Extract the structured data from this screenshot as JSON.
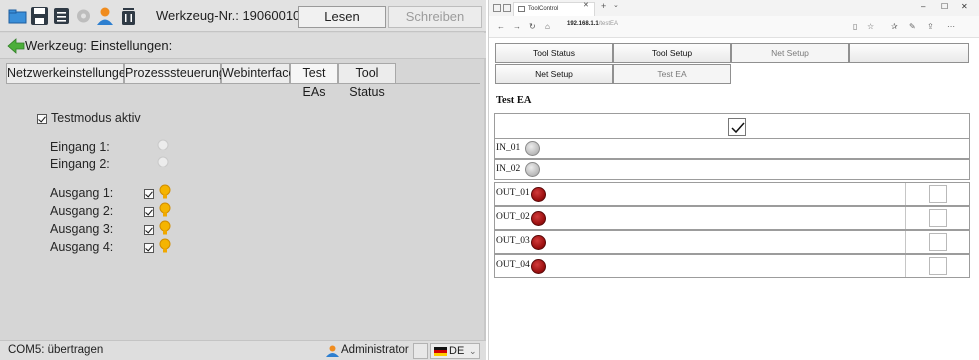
{
  "app": {
    "toolbar": {
      "tool_label": "Werkzeug-Nr.: 19060010",
      "read_label": "Lesen",
      "write_label": "Schreiben"
    },
    "header": {
      "title": "Werkzeug: Einstellungen:"
    },
    "tabs": [
      {
        "label": "Netzwerkeinstellungen",
        "active": false
      },
      {
        "label": "Prozesssteuerung",
        "active": false
      },
      {
        "label": "Webinterface",
        "active": false
      },
      {
        "label": "Test EAs",
        "active": true
      },
      {
        "label": "Tool Status",
        "active": false
      }
    ],
    "test_mode": {
      "label": "Testmodus aktiv",
      "checked": true
    },
    "inputs": [
      {
        "label": "Eingang 1:",
        "state": "off"
      },
      {
        "label": "Eingang 2:",
        "state": "off"
      }
    ],
    "outputs": [
      {
        "label": "Ausgang 1:",
        "checked": true,
        "state": "on"
      },
      {
        "label": "Ausgang 2:",
        "checked": true,
        "state": "on"
      },
      {
        "label": "Ausgang 3:",
        "checked": true,
        "state": "on"
      },
      {
        "label": "Ausgang 4:",
        "checked": true,
        "state": "on"
      }
    ],
    "statusbar": {
      "status": "COM5: übertragen",
      "user": "Administrator",
      "language": "DE"
    }
  },
  "browser": {
    "tab_title": "ToolControl",
    "url_host": "192.168.1.1",
    "url_path": "/testEA",
    "nav_row1": [
      {
        "label": "Tool Status",
        "disabled": false
      },
      {
        "label": "Tool Setup",
        "disabled": false
      },
      {
        "label": "Net Setup",
        "disabled": true
      },
      {
        "label": "",
        "disabled": false
      }
    ],
    "nav_row2": [
      {
        "label": "Net Setup",
        "disabled": false
      },
      {
        "label": "Test EA",
        "disabled": true
      }
    ],
    "section_title": "Test EA",
    "test_checkbox_checked": true,
    "inputs": [
      {
        "label": "IN_01",
        "state": "off"
      },
      {
        "label": "IN_02",
        "state": "off"
      }
    ],
    "outputs": [
      {
        "label": "OUT_01",
        "state": "red",
        "checked": false
      },
      {
        "label": "OUT_02",
        "state": "red",
        "checked": false
      },
      {
        "label": "OUT_03",
        "state": "red",
        "checked": false
      },
      {
        "label": "OUT_04",
        "state": "red",
        "checked": false
      }
    ]
  },
  "colors": {
    "app_bg": "#d6d6d6",
    "bulb_on": "#f5b400",
    "bulb_off": "#e9e9e9",
    "led_red": "#9a0f0f",
    "led_grey": "#b9b9b9"
  }
}
